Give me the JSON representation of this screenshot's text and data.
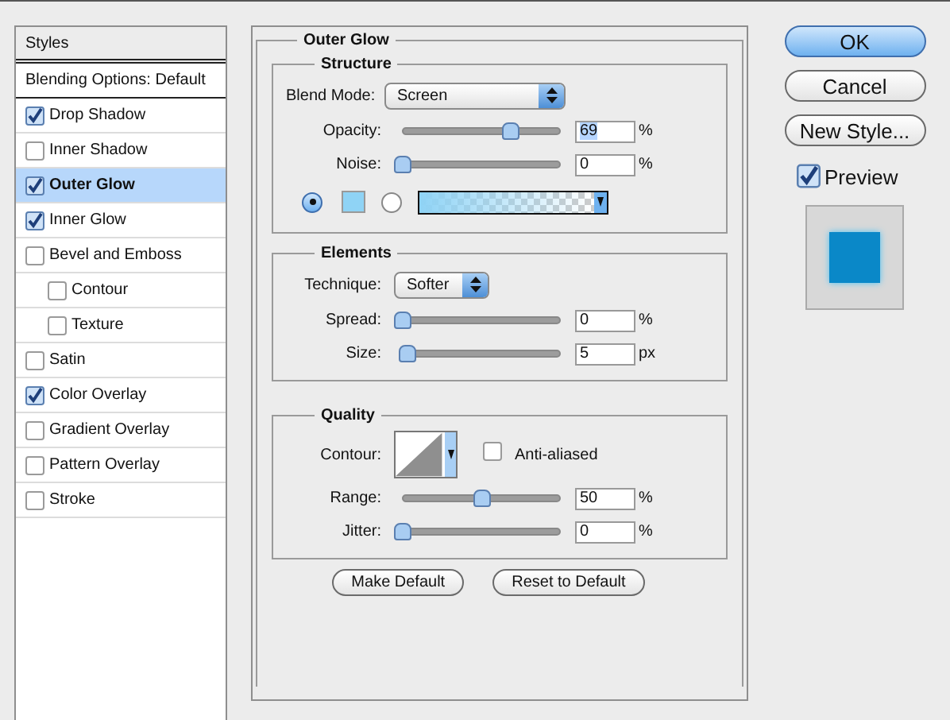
{
  "styles_panel": {
    "header": "Styles",
    "blending_options": "Blending Options: Default",
    "items": [
      {
        "label": "Drop Shadow",
        "checked": true,
        "selected": false
      },
      {
        "label": "Inner Shadow",
        "checked": false,
        "selected": false
      },
      {
        "label": "Outer Glow",
        "checked": true,
        "selected": true
      },
      {
        "label": "Inner Glow",
        "checked": true,
        "selected": false
      },
      {
        "label": "Bevel and Emboss",
        "checked": false,
        "selected": false,
        "children": [
          {
            "label": "Contour",
            "checked": false,
            "selected": false
          },
          {
            "label": "Texture",
            "checked": false,
            "selected": false
          }
        ]
      },
      {
        "label": "Satin",
        "checked": false,
        "selected": false
      },
      {
        "label": "Color Overlay",
        "checked": true,
        "selected": false
      },
      {
        "label": "Gradient Overlay",
        "checked": false,
        "selected": false
      },
      {
        "label": "Pattern Overlay",
        "checked": false,
        "selected": false
      },
      {
        "label": "Stroke",
        "checked": false,
        "selected": false
      }
    ]
  },
  "outer_glow": {
    "title": "Outer Glow",
    "structure": {
      "title": "Structure",
      "blend_mode": {
        "label": "Blend Mode:",
        "value": "Screen"
      },
      "sliders": [
        {
          "label": "Opacity:",
          "level": 0.69,
          "value": "69",
          "unit": "%",
          "highlighted": true
        },
        {
          "label": "Noise:",
          "level": 0,
          "value": "0",
          "unit": "%",
          "highlighted": false
        }
      ],
      "glow_source": [
        {
          "kind": "color",
          "selected": true,
          "color": "#8fd3f5"
        },
        {
          "kind": "gradient",
          "selected": false,
          "color": "#8fd3f5"
        }
      ]
    },
    "elements": {
      "title": "Elements",
      "technique": {
        "label": "Technique:",
        "value": "Softer"
      },
      "sliders": [
        {
          "label": "Spread:",
          "level": 0,
          "value": "0",
          "unit": "%",
          "highlighted": false
        },
        {
          "label": "Size:",
          "level": 0.03,
          "value": "5",
          "unit": "px",
          "highlighted": false
        }
      ]
    },
    "quality": {
      "title": "Quality",
      "contour_label": "Contour:",
      "anti_aliased": {
        "label": "Anti-aliased",
        "checked": false
      },
      "sliders": [
        {
          "label": "Range:",
          "level": 0.5,
          "value": "50",
          "unit": "%",
          "highlighted": false
        },
        {
          "label": "Jitter:",
          "level": 0,
          "value": "0",
          "unit": "%",
          "highlighted": false
        }
      ]
    },
    "buttons": [
      "Make Default",
      "Reset to Default"
    ]
  },
  "actions": [
    {
      "label": "OK",
      "kind": "default"
    },
    {
      "label": "Cancel",
      "kind": "normal"
    },
    {
      "label": "New Style...",
      "kind": "normal"
    }
  ],
  "preview": {
    "label": "Preview",
    "checked": true
  }
}
